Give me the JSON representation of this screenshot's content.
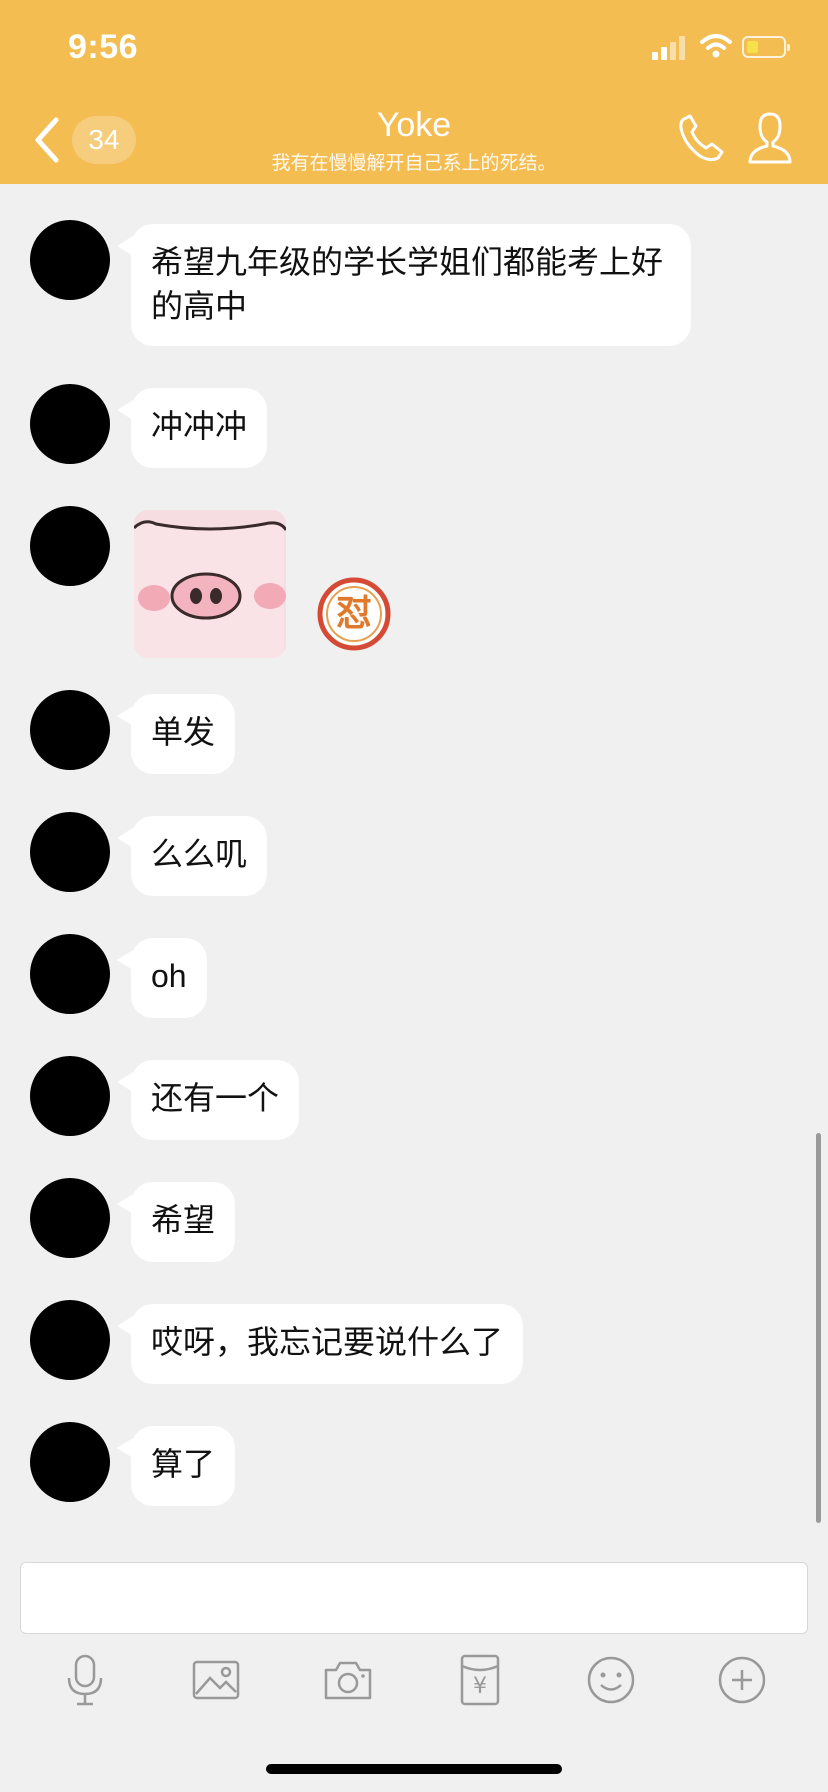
{
  "status_bar": {
    "time": "9:56"
  },
  "header": {
    "unread_count": "34",
    "title": "Yoke",
    "subtitle": "我有在慢慢解开自己系上的死结。"
  },
  "messages": [
    {
      "type": "text",
      "text": "希望九年级的学长学姐们都能考上好的高中"
    },
    {
      "type": "text",
      "text": "冲冲冲"
    },
    {
      "type": "sticker",
      "sticker": "pig-face-sticker",
      "reaction_text": "怼"
    },
    {
      "type": "text",
      "text": "单发"
    },
    {
      "type": "text",
      "text": "么么叽"
    },
    {
      "type": "text",
      "text": "oh"
    },
    {
      "type": "text",
      "text": "还有一个"
    },
    {
      "type": "text",
      "text": "希望"
    },
    {
      "type": "text",
      "text": "哎呀，我忘记要说什么了"
    },
    {
      "type": "text",
      "text": "算了"
    }
  ],
  "toolbar": {
    "icons": [
      "microphone-icon",
      "image-icon",
      "camera-icon",
      "red-packet-icon",
      "emoji-icon",
      "plus-icon"
    ],
    "currency_symbol": "¥"
  },
  "colors": {
    "header": "#f3bd52",
    "background": "#f0f0f0",
    "bubble": "#ffffff"
  }
}
